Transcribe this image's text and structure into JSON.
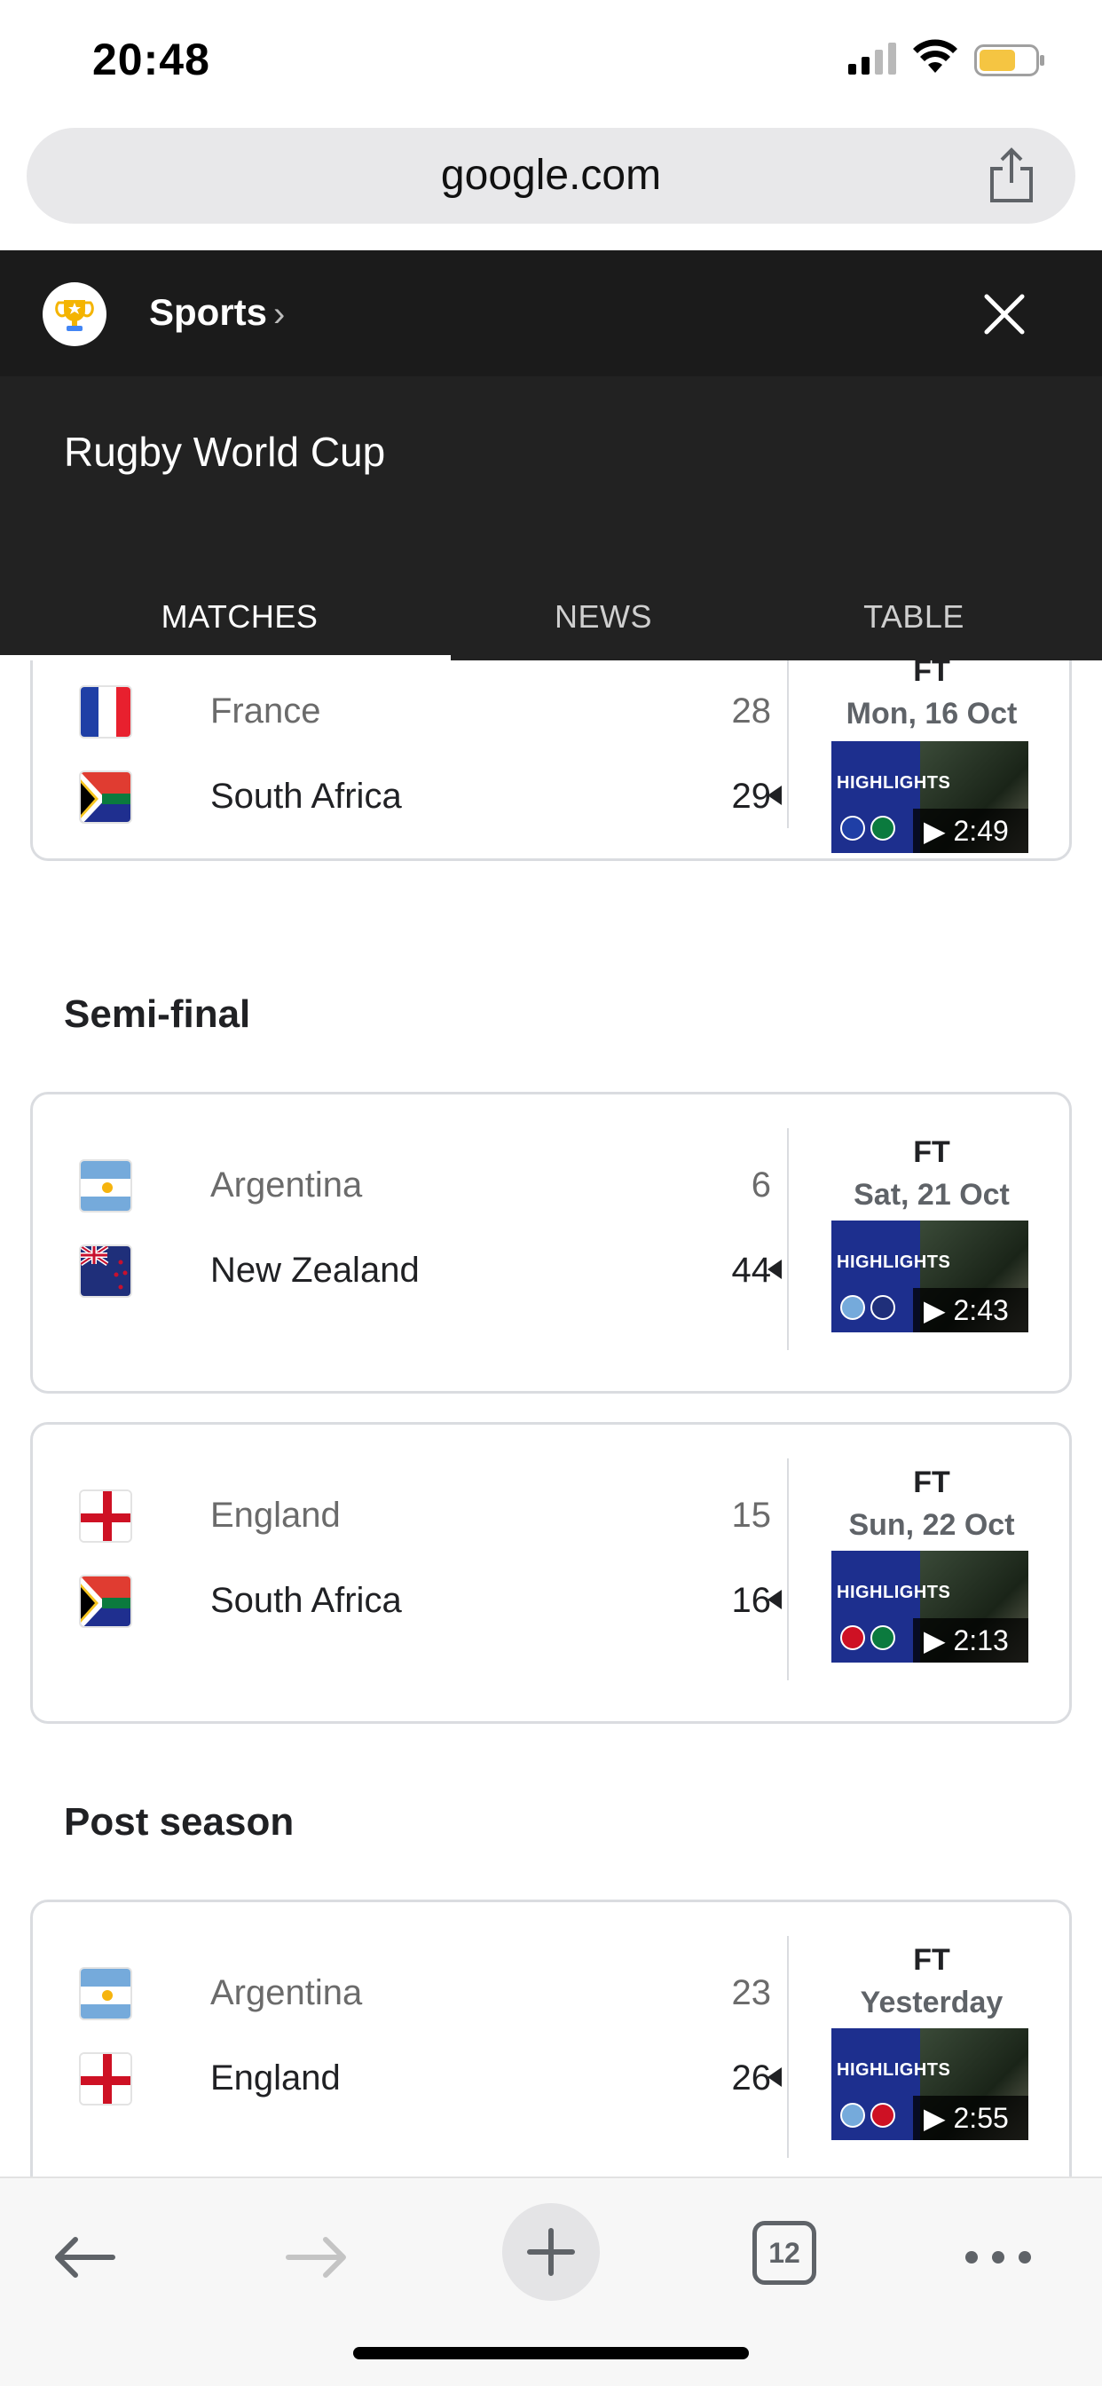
{
  "status_bar": {
    "time": "20:48",
    "battery_color": "#f5c542"
  },
  "browser": {
    "url": "google.com",
    "share_icon": "share-icon"
  },
  "sports_bar": {
    "label": "Sports",
    "chevron": "›",
    "logo_icon": "trophy-icon",
    "close_icon": "close-icon"
  },
  "competition": {
    "title": "Rugby World Cup"
  },
  "tabs": [
    {
      "label": "MATCHES",
      "active": true
    },
    {
      "label": "NEWS",
      "active": false
    },
    {
      "label": "TABLE",
      "active": false
    }
  ],
  "sections": {
    "semi_final": "Semi-final",
    "post_season": "Post season"
  },
  "matches": [
    {
      "team1": "France",
      "score1": "28",
      "team2": "South Africa",
      "score2": "29",
      "status": "FT",
      "date": "Mon, 16 Oct",
      "highlights_label": "HIGHLIGHTS",
      "duration": "▶ 2:49"
    },
    {
      "team1": "Argentina",
      "score1": "6",
      "team2": "New Zealand",
      "score2": "44",
      "status": "FT",
      "date": "Sat, 21 Oct",
      "highlights_label": "HIGHLIGHTS",
      "duration": "▶ 2:43"
    },
    {
      "team1": "England",
      "score1": "15",
      "team2": "South Africa",
      "score2": "16",
      "status": "FT",
      "date": "Sun, 22 Oct",
      "highlights_label": "HIGHLIGHTS",
      "duration": "▶ 2:13"
    },
    {
      "team1": "Argentina",
      "score1": "23",
      "team2": "England",
      "score2": "26",
      "status": "FT",
      "date": "Yesterday",
      "highlights_label": "HIGHLIGHTS",
      "duration": "▶ 2:55"
    }
  ],
  "toolbar": {
    "tab_count": "12"
  }
}
